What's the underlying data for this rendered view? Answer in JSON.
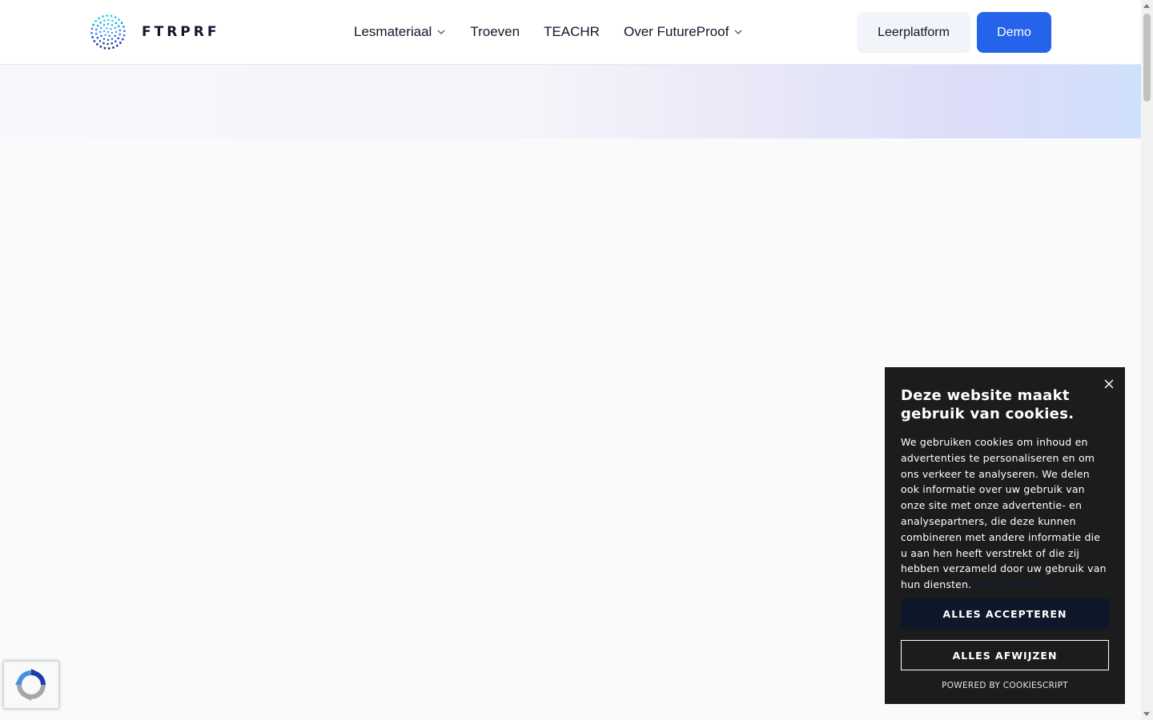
{
  "logo": {
    "text": "FTRPRF",
    "icon": "dot-sphere-logo-icon",
    "colors": [
      "#22d3ee",
      "#0ea5e9",
      "#3b82f6",
      "#1d4ed8",
      "#1e3a8a"
    ]
  },
  "nav": {
    "items": [
      {
        "label": "Lesmateriaal",
        "has_dropdown": true
      },
      {
        "label": "Troeven",
        "has_dropdown": false
      },
      {
        "label": "TEACHR",
        "has_dropdown": false
      },
      {
        "label": "Over FutureProof",
        "has_dropdown": true
      }
    ]
  },
  "header_buttons": {
    "leerplatform": "Leerplatform",
    "demo": "Demo"
  },
  "colors": {
    "primary": "#2563eb",
    "dark": "#0f172a",
    "dialog_bg": "#1c1c1e",
    "page_bg": "#f8fafc"
  },
  "cookie": {
    "title": "Deze website maakt gebruik van cookies.",
    "body": "We gebruiken cookies om inhoud en advertenties te personaliseren en om ons verkeer te analyseren. We delen ook informatie over uw gebruik van onze site met onze advertentie- en analysepartners, die deze kunnen combineren met andere informatie die u aan hen heeft verstrekt of die zij hebben verzameld door uw gebruik van hun diensten.",
    "link": "Privacybeleid",
    "accept": "ALLES ACCEPTEREN",
    "reject": "ALLES AFWIJZEN",
    "powered": "POWERED BY COOKIESCRIPT",
    "close_icon": "close-icon"
  },
  "recaptcha": {
    "icon": "recaptcha-icon"
  }
}
